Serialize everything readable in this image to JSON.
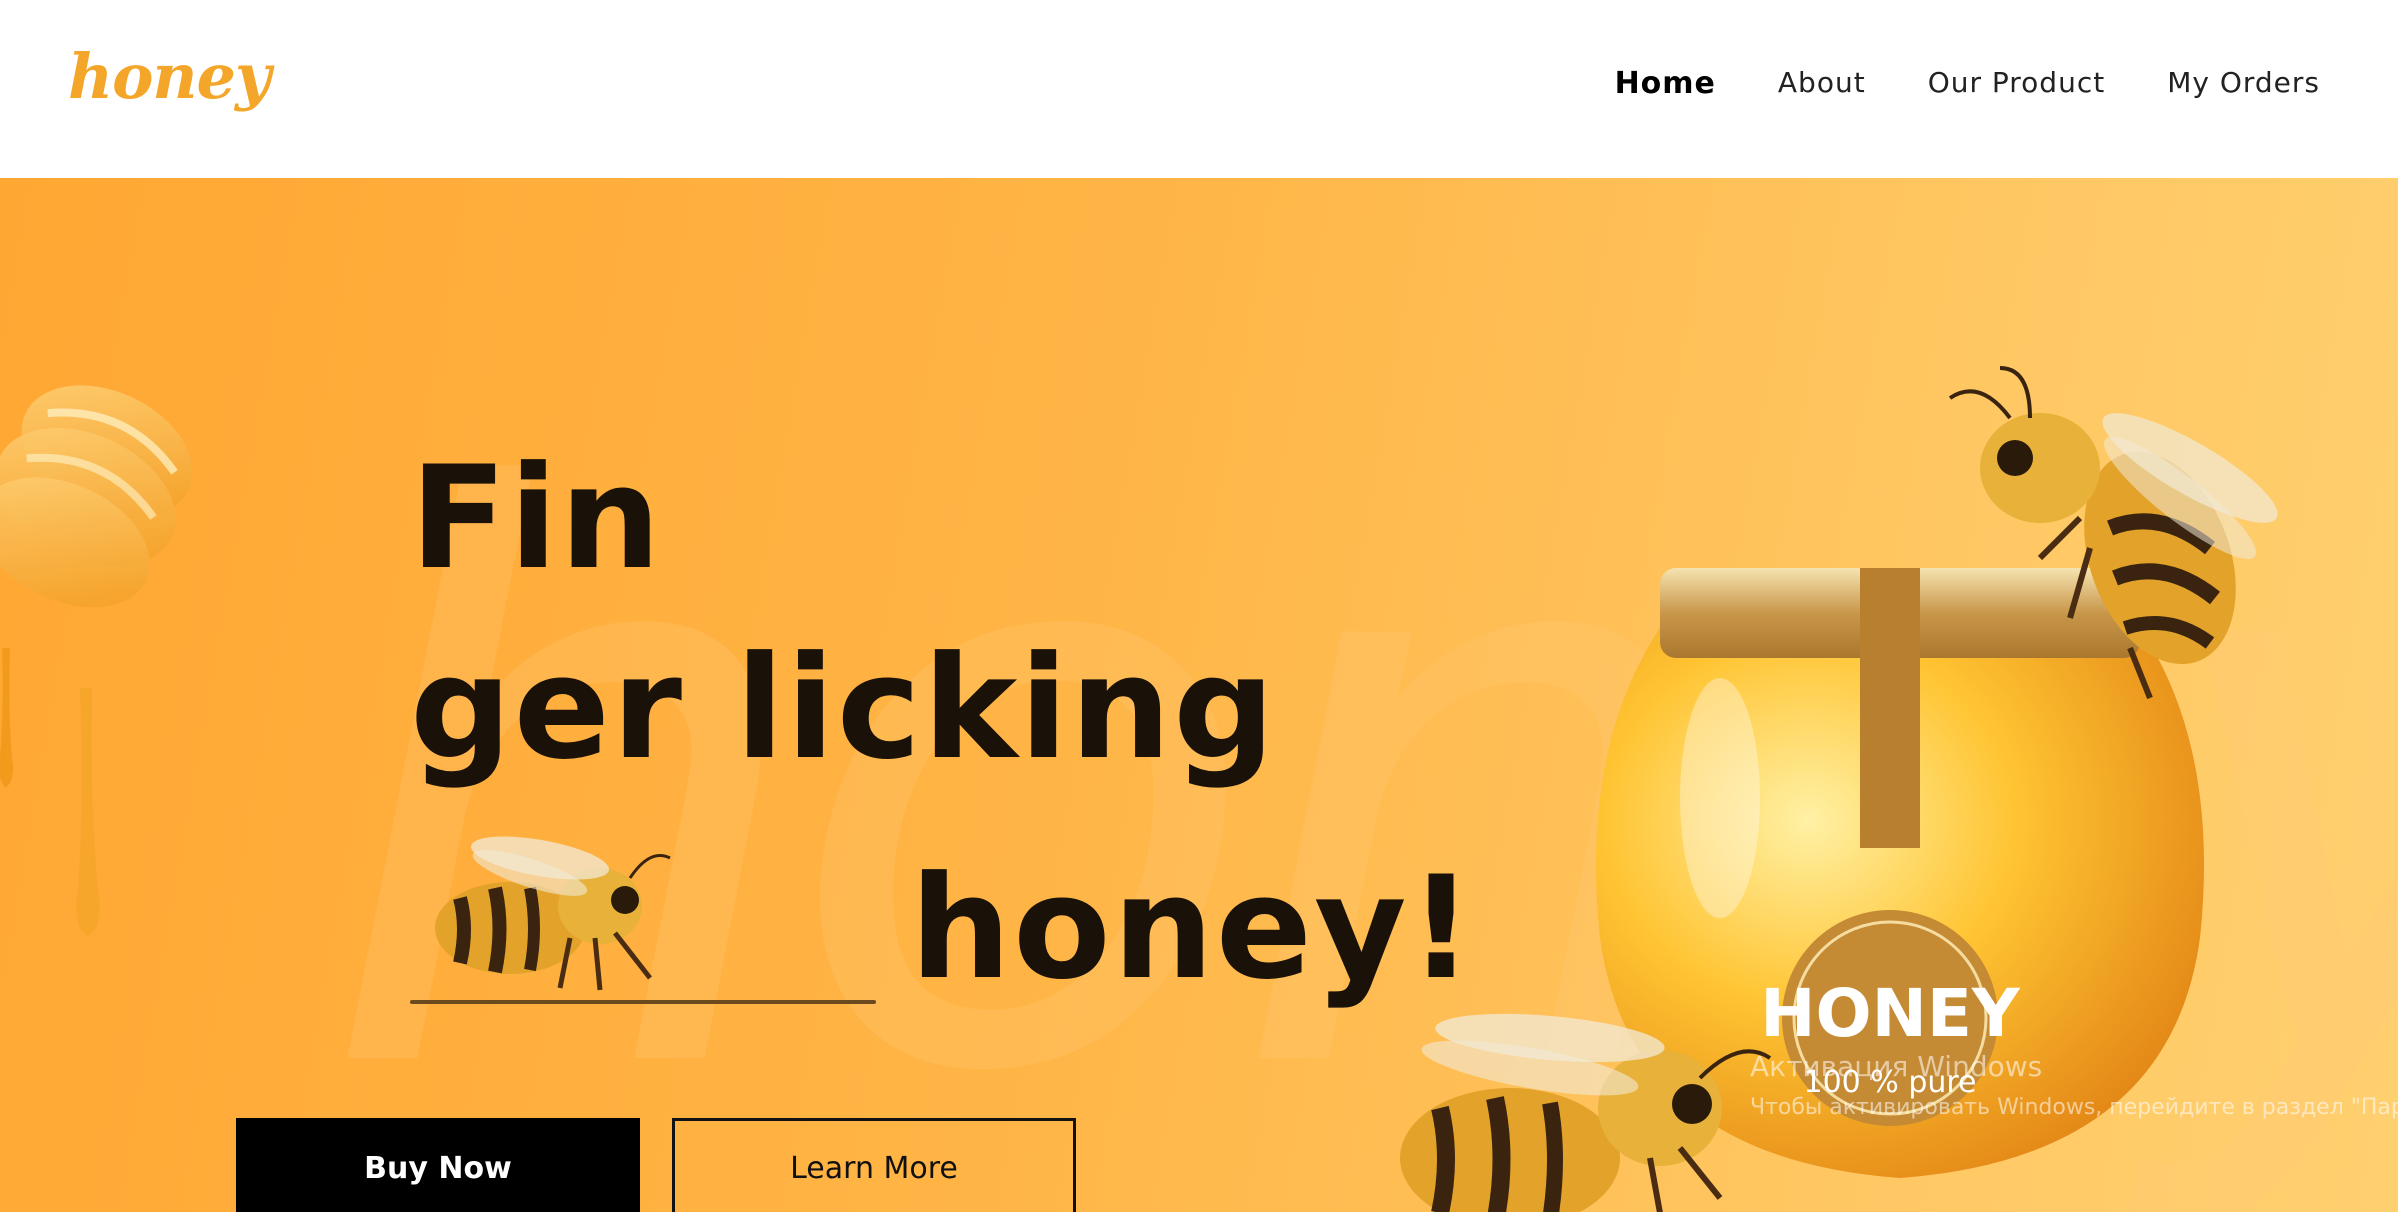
{
  "header": {
    "logo": "honey",
    "nav": [
      {
        "label": "Home",
        "active": true
      },
      {
        "label": "About",
        "active": false
      },
      {
        "label": "Our Product",
        "active": false
      },
      {
        "label": "My Orders",
        "active": false
      }
    ]
  },
  "hero": {
    "headline_lines": [
      "Fin",
      "ger licking",
      "honey!"
    ],
    "watermark": "honey",
    "buttons": {
      "buy": "Buy Now",
      "learn": "Learn More"
    },
    "jar_label": {
      "title": "HONEY",
      "subtitle": "100 % pure"
    }
  },
  "system_overlay": {
    "title": "Активация Windows",
    "message": "Чтобы активировать Windows, перейдите в раздел \"Параметр"
  },
  "colors": {
    "brand": "#f4a62a",
    "hero_start": "#ffa733",
    "hero_end": "#ffd070",
    "text_dark": "#1a1208",
    "button_dark": "#000000"
  }
}
